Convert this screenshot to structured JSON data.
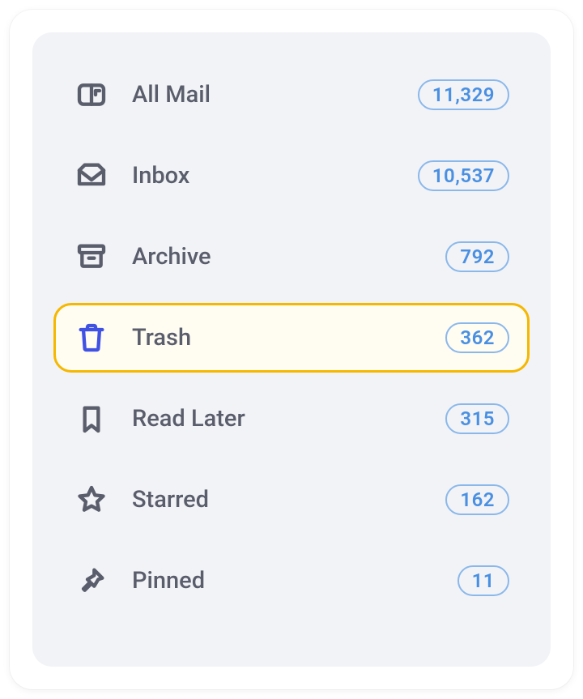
{
  "sidebar": {
    "items": [
      {
        "id": "all-mail",
        "label": "All Mail",
        "count": "11,329",
        "icon": "mailbox-icon",
        "selected": false
      },
      {
        "id": "inbox",
        "label": "Inbox",
        "count": "10,537",
        "icon": "inbox-icon",
        "selected": false
      },
      {
        "id": "archive",
        "label": "Archive",
        "count": "792",
        "icon": "archive-icon",
        "selected": false
      },
      {
        "id": "trash",
        "label": "Trash",
        "count": "362",
        "icon": "trash-icon",
        "selected": true
      },
      {
        "id": "read-later",
        "label": "Read Later",
        "count": "315",
        "icon": "bookmark-icon",
        "selected": false
      },
      {
        "id": "starred",
        "label": "Starred",
        "count": "162",
        "icon": "star-icon",
        "selected": false
      },
      {
        "id": "pinned",
        "label": "Pinned",
        "count": "11",
        "icon": "pin-icon",
        "selected": false
      }
    ]
  },
  "colors": {
    "accent_border": "#f5b700",
    "accent_bg": "#fffcf2",
    "selected_icon": "#4052e3",
    "badge_text": "#4a90e2",
    "badge_border": "#8bb8ea",
    "text": "#5a5d6b",
    "panel_bg": "#f2f3f7"
  }
}
